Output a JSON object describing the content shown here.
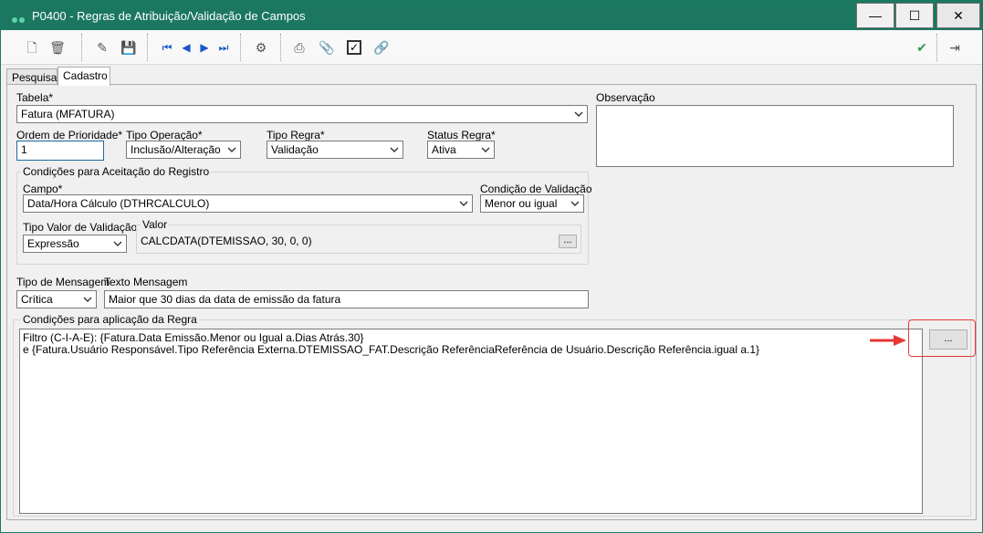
{
  "window": {
    "title": "P0400 - Regras de Atribuição/Validação de Campos",
    "buttons": {
      "minimize": "—",
      "maximize": "☐",
      "close": "✕"
    },
    "accent": "#1b7760"
  },
  "toolbar": {
    "icons": [
      "new-icon",
      "delete-icon",
      "edit-icon",
      "save-icon",
      "first-icon",
      "prev-icon",
      "next-icon",
      "last-icon",
      "execute-icon",
      "print-icon",
      "attach-icon",
      "check-icon",
      "link-icon",
      "confirm-icon",
      "exit-icon"
    ]
  },
  "tabs": [
    {
      "label": "Pesquisa",
      "active": false
    },
    {
      "label": "Cadastro",
      "active": true
    }
  ],
  "form": {
    "tabela": {
      "label": "Tabela*",
      "value": "Fatura (MFATURA)"
    },
    "observacao": {
      "label": "Observação",
      "value": ""
    },
    "ordem": {
      "label": "Ordem de Prioridade*",
      "value": "1"
    },
    "tipo_operacao": {
      "label": "Tipo Operação*",
      "value": "Inclusão/Alteração"
    },
    "tipo_regra": {
      "label": "Tipo Regra*",
      "value": "Validação"
    },
    "status_regra": {
      "label": "Status Regra*",
      "value": "Ativa"
    },
    "condicoes_aceitacao": {
      "title": "Condições para Aceitação do Registro",
      "campo": {
        "label": "Campo*",
        "value": "Data/Hora Cálculo (DTHRCALCULO)"
      },
      "condicao_validacao": {
        "label": "Condição de Validação",
        "value": "Menor ou igual"
      },
      "tipo_valor": {
        "label": "Tipo Valor de Validação",
        "value": "Expressão"
      },
      "valor": {
        "label": "Valor",
        "value": "CALCDATA(DTEMISSAO, 30, 0, 0)",
        "button": "..."
      }
    },
    "tipo_mensagem": {
      "label": "Tipo de Mensagem",
      "value": "Crítica"
    },
    "texto_mensagem": {
      "label": "Texto Mensagem",
      "value": "Maior que 30 dias da data de emissão da fatura"
    },
    "condicoes_aplicacao": {
      "title": "Condições para aplicação da Regra",
      "lines": [
        "Filtro (C-I-A-E): {Fatura.Data Emissão.Menor ou Igual a.Dias Atrás.30}",
        "e {Fatura.Usuário Responsável.Tipo Referência Externa.DTEMISSAO_FAT.Descrição ReferênciaReferência de Usuário.Descrição Referência.igual a.1}"
      ],
      "button": "..."
    }
  },
  "annotation": {
    "color": "#e53935"
  }
}
